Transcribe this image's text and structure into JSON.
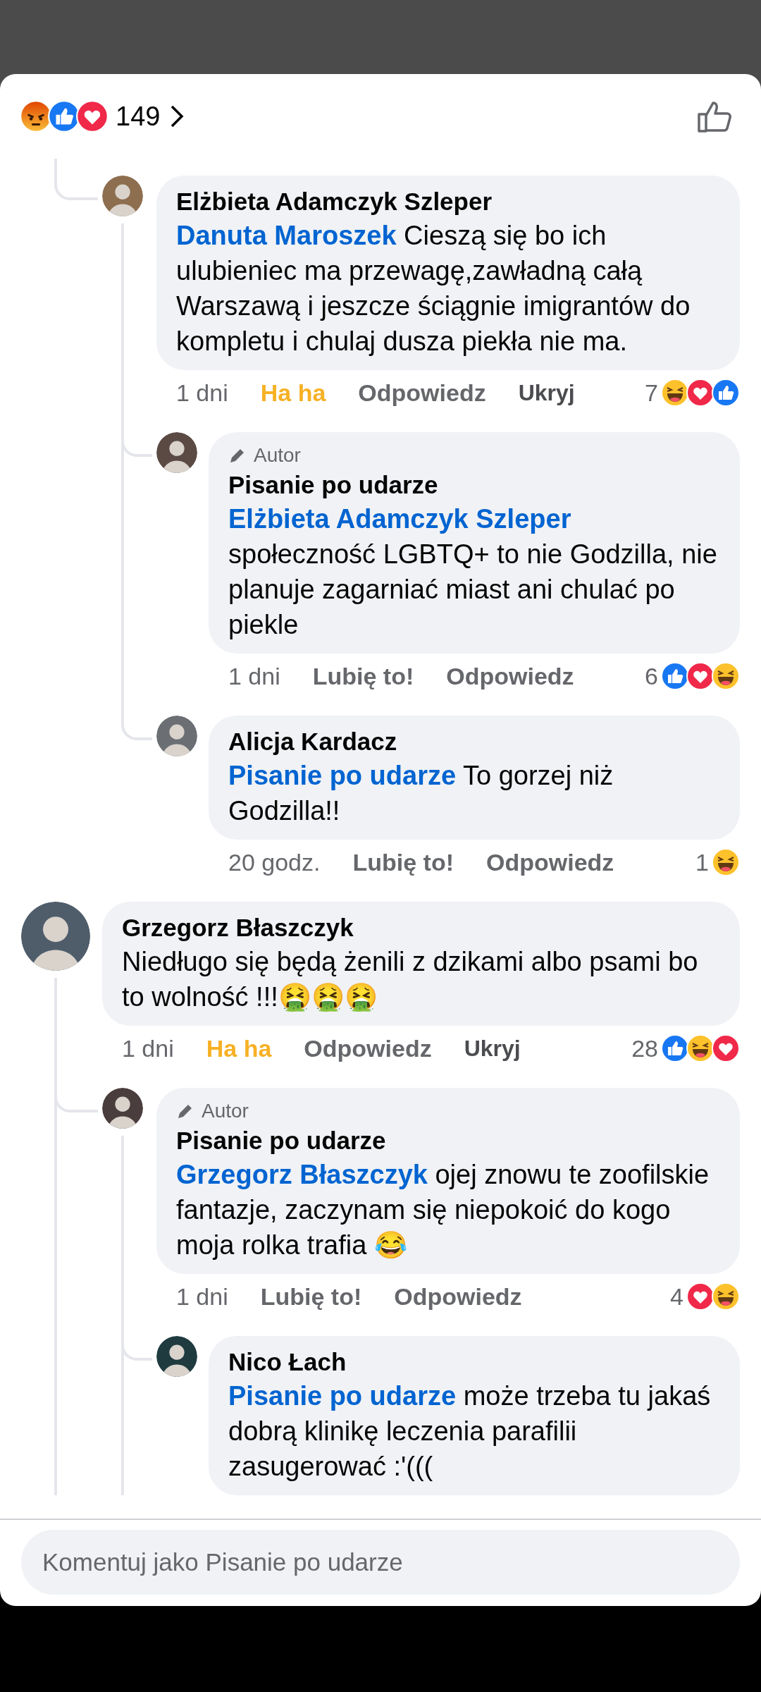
{
  "header": {
    "reactions": [
      {
        "kind": "angry"
      },
      {
        "kind": "like"
      },
      {
        "kind": "love"
      }
    ],
    "count": "149"
  },
  "comments": [
    {
      "kind": "reply",
      "author": "Elżbieta Adamczyk Szleper",
      "mention": "Danuta Maroszek",
      "text": "Cieszą się bo ich ulubieniec ma przewagę,zawładną całą Warszawą i jeszcze ściągnie imigrantów do kompletu i chulaj dusza piekła nie ma.",
      "time": "1 dni",
      "reaction": {
        "kind": "haha",
        "label": "Ha ha"
      },
      "reply_label": "Odpowiedz",
      "hide_label": "Ukryj",
      "reaction_count": "7",
      "reactions": [
        {
          "kind": "haha"
        },
        {
          "kind": "love"
        },
        {
          "kind": "like"
        }
      ],
      "more_replies": false,
      "children": [
        {
          "badge": "Autor",
          "author": "Pisanie po udarze",
          "mention": "Elżbieta Adamczyk Szleper",
          "text": "społeczność LGBTQ+ to nie Godzilla, nie planuje zagarniać miast ani chulać po piekle",
          "time": "1 dni",
          "reaction": {
            "kind": "none",
            "label": "Lubię to!"
          },
          "reply_label": "Odpowiedz",
          "reaction_count": "6",
          "reactions": [
            {
              "kind": "like"
            },
            {
              "kind": "love"
            },
            {
              "kind": "haha"
            }
          ]
        },
        {
          "author": "Alicja Kardacz",
          "mention": "Pisanie po udarze",
          "text": "To gorzej niż Godzilla!!",
          "time": "20 godz.",
          "reaction": {
            "kind": "none",
            "label": "Lubię to!"
          },
          "reply_label": "Odpowiedz",
          "reaction_count": "1",
          "reactions": [
            {
              "kind": "haha"
            }
          ]
        }
      ]
    },
    {
      "kind": "comment",
      "author": "Grzegorz Błaszczyk",
      "text": "Niedługo się będą żenili z dzikami albo psami bo to wolność !!!🤮🤮🤮",
      "time": "1 dni",
      "reaction": {
        "kind": "haha",
        "label": "Ha ha"
      },
      "reply_label": "Odpowiedz",
      "hide_label": "Ukryj",
      "reaction_count": "28",
      "reactions": [
        {
          "kind": "like"
        },
        {
          "kind": "haha"
        },
        {
          "kind": "love"
        }
      ],
      "more_replies": true,
      "children": [
        {
          "badge": "Autor",
          "author": "Pisanie po udarze",
          "mention": "Grzegorz Błaszczyk",
          "text": "ojej znowu te zoofilskie fantazje, zaczynam się niepokoić do kogo moja rolka trafia 😂",
          "time": "1 dni",
          "reaction": {
            "kind": "none",
            "label": "Lubię to!"
          },
          "reply_label": "Odpowiedz",
          "reaction_count": "4",
          "reactions": [
            {
              "kind": "love"
            },
            {
              "kind": "haha"
            }
          ],
          "more_replies": true,
          "children": [
            {
              "author": "Nico Łach",
              "mention": "Pisanie po udarze",
              "text": "może trzeba tu jakaś dobrą klinikę leczenia parafilii zasugerować :'((("
            }
          ]
        }
      ]
    }
  ],
  "composer": {
    "placeholder": "Komentuj jako Pisanie po udarze"
  }
}
